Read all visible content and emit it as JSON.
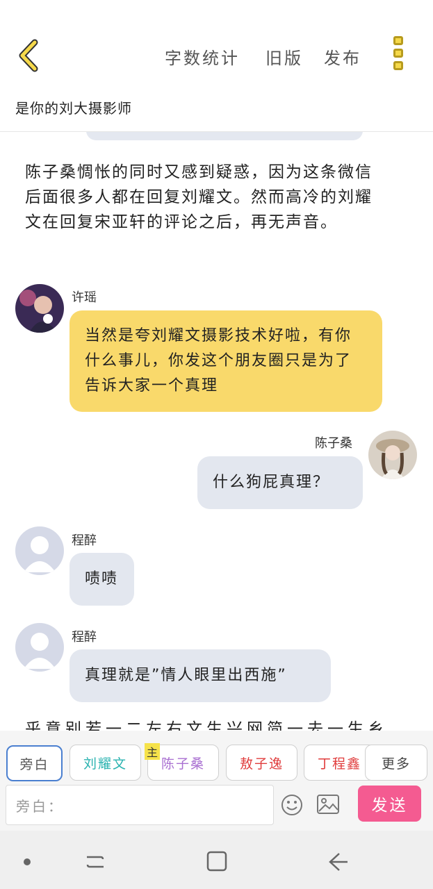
{
  "header": {
    "actions": [
      {
        "label": "字数统计"
      },
      {
        "label": "旧版"
      },
      {
        "label": "发布"
      }
    ],
    "story_title": "是你的刘大摄影师"
  },
  "chat": {
    "narration": "陈子桑惆怅的同时又感到疑惑，因为这条微信后面很多人都在回复刘耀文。然而高冷的刘耀文在回复宋亚轩的评论之后，再无声音。",
    "messages": [
      {
        "sender": "许瑶",
        "text": "当然是夸刘耀文摄影技术好啦，有你什么事儿，你发这个朋友圈只是为了告诉大家一个真理",
        "side": "left",
        "color": "#f9d96b"
      },
      {
        "sender": "陈子桑",
        "text": "什么狗屁真理？",
        "side": "right",
        "color": "#e3e7ef"
      },
      {
        "sender": "程醉",
        "text": "啧啧",
        "side": "left",
        "color": "#e3e7ef"
      },
      {
        "sender": "程醉",
        "text": "真理就是”情人眼里出西施”",
        "side": "left",
        "color": "#e3e7ef"
      }
    ],
    "cut_text": "乎意别若一二左右文生兴网简一去一生乡"
  },
  "roles": {
    "items": [
      {
        "label": "旁白",
        "color": "#555555",
        "active": true
      },
      {
        "label": "刘耀文",
        "color": "#2ab3b0"
      },
      {
        "label": "陈子桑",
        "color": "#a96fd1"
      },
      {
        "label": "敖子逸",
        "color": "#e03c3c"
      },
      {
        "label": "丁程鑫",
        "color": "#e03c3c"
      }
    ],
    "host_tag": "主",
    "more_label": "更多"
  },
  "input": {
    "placeholder": "旁白：",
    "send_label": "发送"
  },
  "colors": {
    "accent_yellow": "#f6d94a",
    "send_pink": "#f45b91",
    "bubble_grey": "#e3e7ef",
    "bubble_yellow": "#f9d96b"
  }
}
